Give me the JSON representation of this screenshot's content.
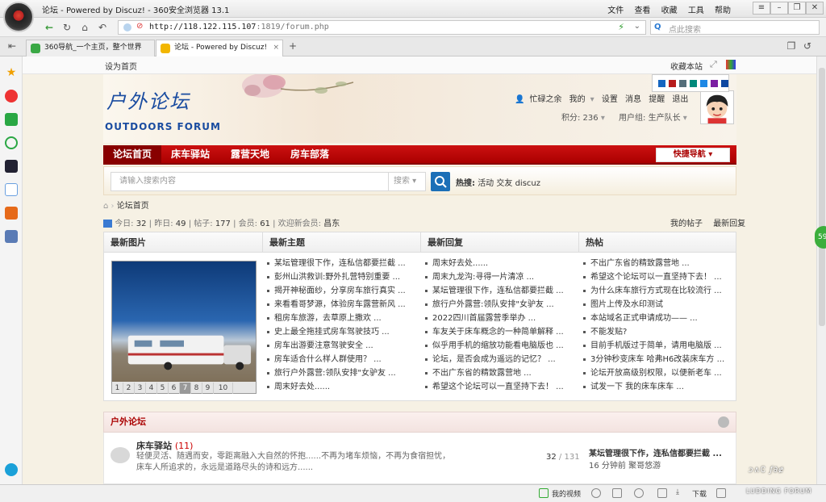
{
  "browser": {
    "title": "论坛 - Powered by Discuz! - 360安全浏览器 13.1",
    "menus": [
      "文件",
      "查看",
      "收藏",
      "工具",
      "帮助"
    ],
    "url_host": "http://118.122.115.107",
    "url_path": ":1819/forum.php",
    "search_placeholder": "点此搜索",
    "tabs": [
      {
        "label": "360导航_一个主页，整个世界"
      },
      {
        "label": "论坛 - Powered by Discuz!"
      }
    ]
  },
  "topstrip": {
    "set_home": "设为首页",
    "favorite": "收藏本站"
  },
  "header": {
    "logo_cn": "户外论坛",
    "logo_en": "OUTDOORS FORUM",
    "username": "忙碌之余",
    "links": [
      "我的",
      "设置",
      "消息",
      "提醒",
      "退出"
    ],
    "points": "积分: 236",
    "usergroup": "用户组: 生产队长"
  },
  "nav": {
    "items": [
      "论坛首页",
      "床车驿站",
      "露营天地",
      "房车部落"
    ],
    "quick_nav": "快捷导航"
  },
  "search": {
    "placeholder": "请输入搜索内容",
    "select": "搜索",
    "hot_label": "热搜:",
    "hot_words": [
      "活动",
      "交友",
      "discuz"
    ]
  },
  "breadcrumb": "论坛首页",
  "stats": {
    "today_label": "今日:",
    "today": "32",
    "yesterday_label": "昨日:",
    "yesterday": "49",
    "posts_label": "帖子:",
    "posts": "177",
    "members_label": "会员:",
    "members": "61",
    "welcome_label": "欢迎新会员:",
    "welcome": "昌东"
  },
  "right_links": [
    "我的帖子",
    "最新回复"
  ],
  "columns": {
    "headers": [
      "最新图片",
      "最新主题",
      "最新回复",
      "热帖"
    ],
    "pages": [
      "1",
      "2",
      "3",
      "4",
      "5",
      "6",
      "7",
      "8",
      "9",
      "10"
    ],
    "new_topics": [
      "某坛管理很下作，连私信都要拦截 ...",
      "彭州山洪救训:野外扎营特别重要 ...",
      "揭开神秘面纱，分享房车旅行真实 ...",
      "来看看哥梦源，体验房车露营新风 ...",
      "租房车旅游，去草原上撒欢 ...",
      "史上最全拖挂式房车驾驶技巧 ...",
      "房车出游要注意驾驶安全 ...",
      "房车适合什么样人群使用？ ...",
      "旅行户外露营:领队安排\"女驴友 ...",
      "周末好去处......"
    ],
    "new_replies": [
      "周末好去处......",
      "周末九龙沟:寻得一片清凉 ...",
      "某坛管理很下作，连私信都要拦截 ...",
      "旅行户外露营:领队安排\"女驴友 ...",
      "2022四川首届露营季举办 ...",
      "车友关于床车概念的一种简单解释 ...",
      "似乎用手机的缩放功能看电脑版也 ...",
      "论坛，是否会成为遥远的记忆？ ...",
      "不出广东省的精致露营地 ...",
      "希望这个论坛可以一直坚持下去！ ..."
    ],
    "hot": [
      "不出广东省的精致露营地 ...",
      "希望这个论坛可以一直坚持下去！ ...",
      "为什么床车旅行方式现在比较流行 ...",
      "图片上传及水印测试",
      "本站域名正式申请成功—— ...",
      "不能发贴?",
      "目前手机版过于简单，请用电脑版 ...",
      "3分钟秒变床车 哈弗H6改装床车方 ...",
      "论坛开放高级别权限，以便新老车 ...",
      "试发一下 我的床车床车 ..."
    ]
  },
  "section": {
    "title": "户外论坛",
    "forum_name": "床车驿站",
    "forum_count": "(11)",
    "forum_desc": "轻便灵活、随遇而安，零距离融入大自然的怀抱......不再为堵车烦恼，不再为食宿担忧，床车人所追求的，永远是道路尽头的诗和远方......",
    "threads": "32",
    "sep": "/",
    "total": "131",
    "last_title": "某坛管理很下作，连私信都要拦截 ...",
    "last_time": "16 分钟前 聚哥悠游"
  },
  "statusbar": {
    "video": "我的视频",
    "download": "下载"
  },
  "side_badge": "59",
  "watermark": {
    "sig": "ↄ∧∁ ƒ∂ɇ",
    "text": "LUDDING FORUM"
  },
  "colors": {
    "nav_red": "#b00000",
    "logo_blue": "#1a4ca0",
    "accent_green": "#3cae3c"
  },
  "color_swatches": [
    "#1565c0",
    "#b71c1c",
    "#546e7a",
    "#00897b",
    "#1e88e5",
    "#7b1fa2",
    "#0d47a1"
  ]
}
